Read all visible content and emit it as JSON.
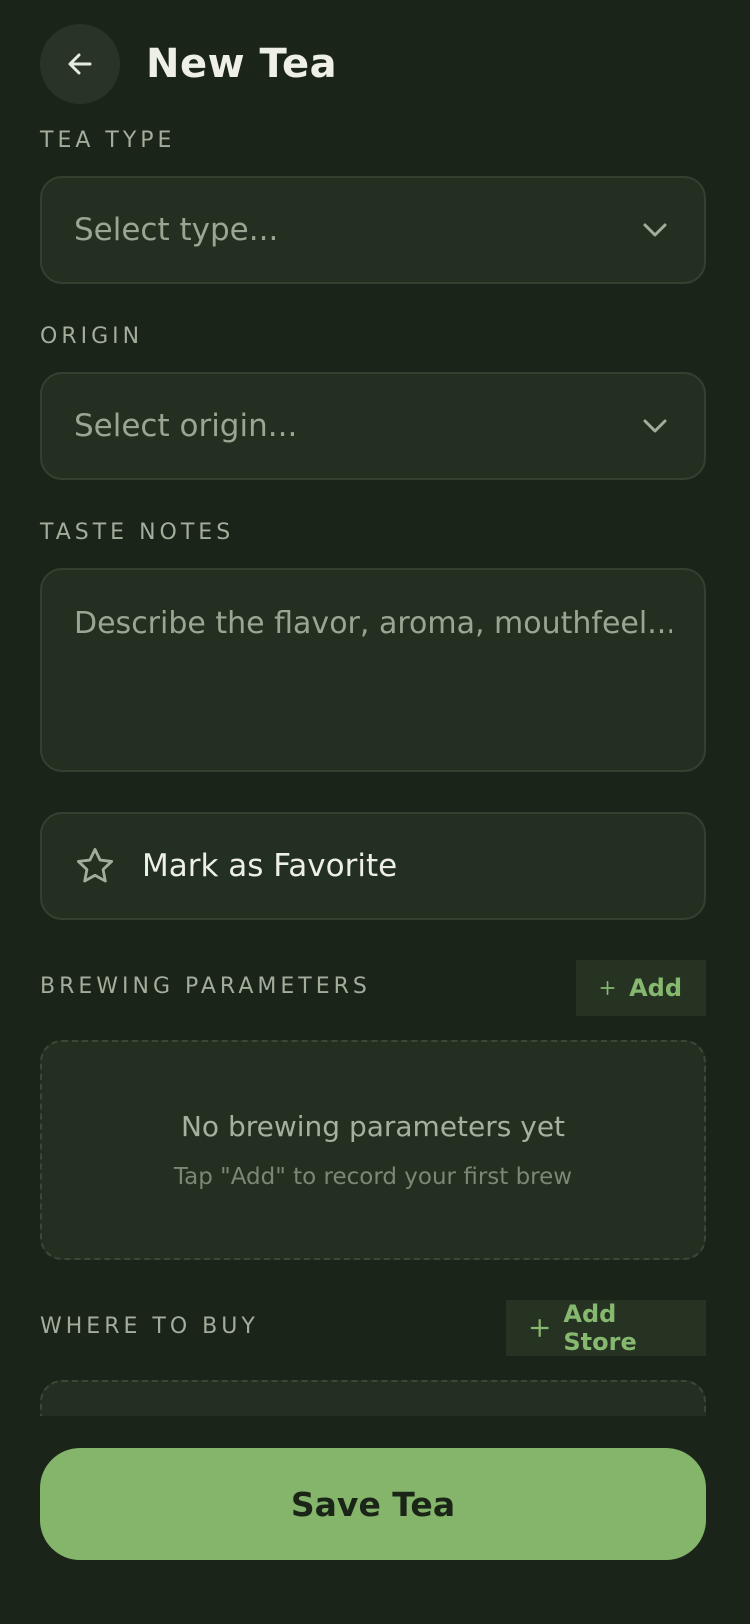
{
  "header": {
    "title": "New Tea",
    "back_icon": "arrow-left-icon"
  },
  "tea_type": {
    "label": "TEA TYPE",
    "placeholder": "Select type..."
  },
  "origin": {
    "label": "ORIGIN",
    "placeholder": "Select origin..."
  },
  "taste_notes": {
    "label": "TASTE NOTES",
    "placeholder": "Describe the flavor, aroma, mouthfeel..."
  },
  "favorite": {
    "label": "Mark as Favorite",
    "icon": "star-outline-icon"
  },
  "brewing": {
    "label": "BREWING PARAMETERS",
    "add_label": "Add",
    "empty_title": "No brewing parameters yet",
    "empty_subtitle": "Tap \"Add\" to record your first brew"
  },
  "where_to_buy": {
    "label": "WHERE TO BUY",
    "add_label": "Add Store"
  },
  "save_button": {
    "label": "Save Tea"
  },
  "colors": {
    "background": "#1b2418",
    "accent": "#84b56b",
    "field": "#232f21"
  }
}
